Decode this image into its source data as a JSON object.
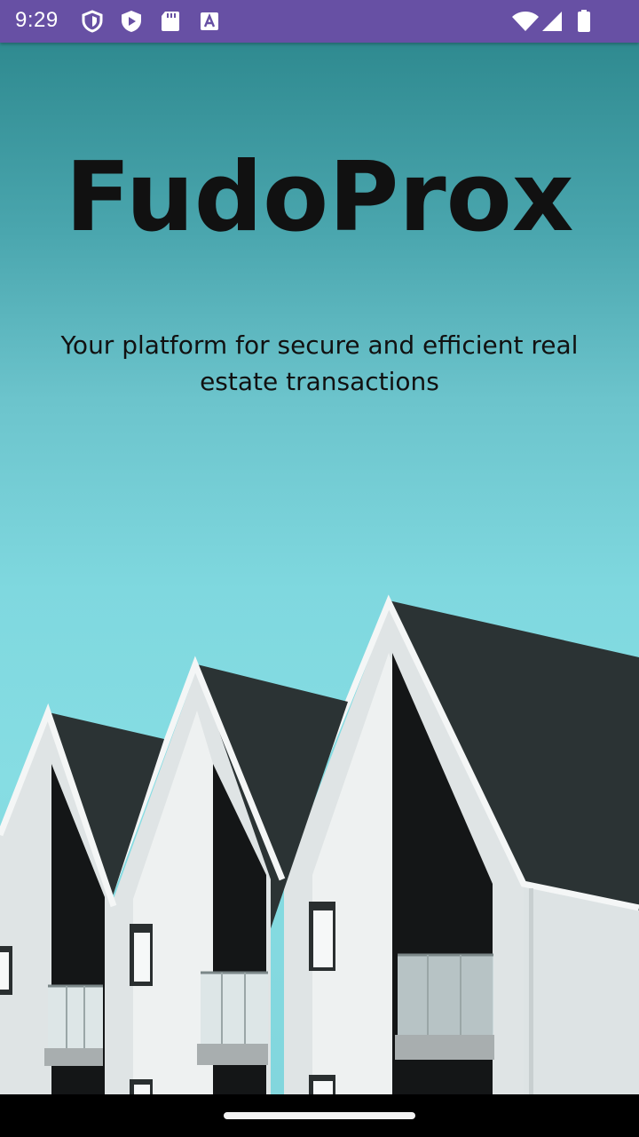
{
  "status_bar": {
    "time": "9:29",
    "left_icons": [
      "shield-icon",
      "play-protect-icon",
      "sd-card-icon",
      "text-a-icon"
    ],
    "right_icons": [
      "wifi-icon",
      "signal-icon",
      "battery-icon"
    ],
    "background_color": "#6750A4"
  },
  "hero": {
    "title": "FudoProx",
    "subtitle": "Your platform for secure and efficient real estate transactions",
    "background_image": "houses-with-dark-gabled-roofs"
  },
  "navigation_bar": {
    "gesture_handle": "home-pill"
  }
}
